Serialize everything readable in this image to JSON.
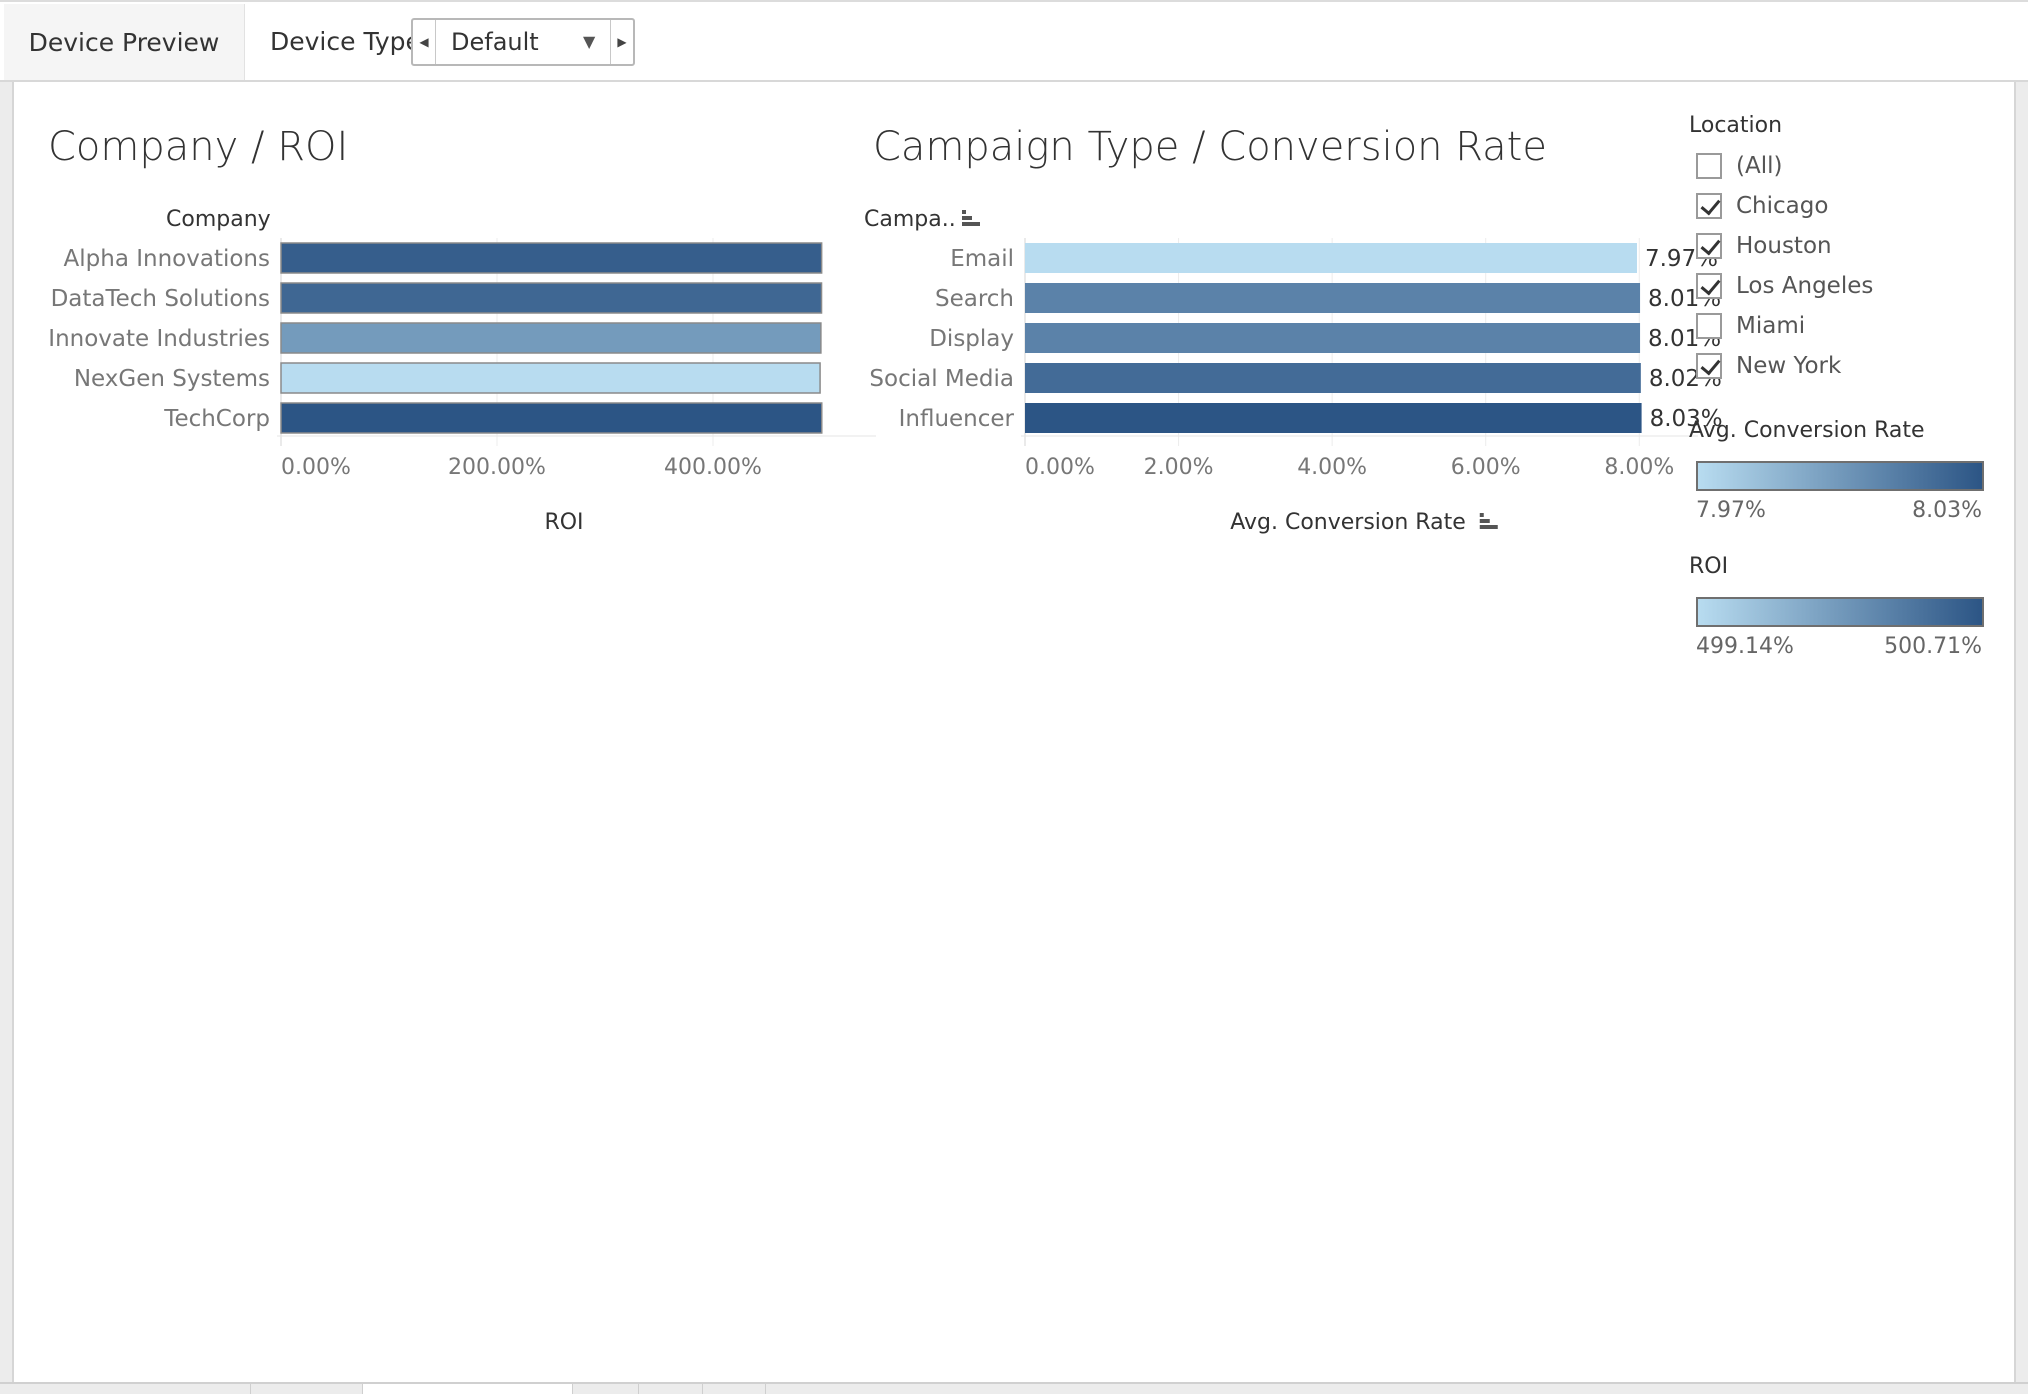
{
  "toolbar": {
    "tab_label": "Device Preview",
    "device_type_label": "Device Type",
    "device_type_value": "Default"
  },
  "charts_titles": {
    "roi_title": "Company / ROI",
    "conversion_title": "Campaign Type / Conversion Rate"
  },
  "chart_data": [
    {
      "type": "bar",
      "orientation": "horizontal",
      "title": "Company / ROI",
      "ylabel": "Company",
      "xlabel": "ROI",
      "categories": [
        "Alpha Innovations",
        "DataTech Solutions",
        "Innovate Industries",
        "NexGen Systems",
        "TechCorp"
      ],
      "values": [
        500.6,
        500.5,
        499.9,
        499.14,
        500.71
      ],
      "value_unit": "%",
      "xlim": [
        0,
        525
      ],
      "ticks": [
        {
          "value": 0,
          "label": "0.00%"
        },
        {
          "value": 200,
          "label": "200.00%"
        },
        {
          "value": 400,
          "label": "400.00%"
        }
      ],
      "color_scale": {
        "min": 499.14,
        "max": 500.71,
        "min_color": "#b8dcf0",
        "max_color": "#2c5585"
      },
      "grid": true
    },
    {
      "type": "bar",
      "orientation": "horizontal",
      "title": "Campaign Type / Conversion Rate",
      "ylabel": "Campa..",
      "xlabel": "Avg. Conversion Rate",
      "categories": [
        "Email",
        "Search",
        "Display",
        "Social Media",
        "Influencer"
      ],
      "values": [
        7.97,
        8.01,
        8.01,
        8.02,
        8.03
      ],
      "data_labels": [
        "7.97%",
        "8.01%",
        "8.01%",
        "8.02%",
        "8.03%"
      ],
      "value_unit": "%",
      "xlim": [
        0,
        8.4
      ],
      "ticks": [
        {
          "value": 0,
          "label": "0.00%"
        },
        {
          "value": 2,
          "label": "2.00%"
        },
        {
          "value": 4,
          "label": "4.00%"
        },
        {
          "value": 6,
          "label": "6.00%"
        },
        {
          "value": 8,
          "label": "8.00%"
        }
      ],
      "color_scale": {
        "min": 7.97,
        "max": 8.03,
        "min_color": "#b8dcf0",
        "max_color": "#2c5585"
      },
      "grid": true,
      "sorted": true
    }
  ],
  "location_filter": {
    "title": "Location",
    "items": [
      {
        "label": "(All)",
        "checked": false
      },
      {
        "label": "Chicago",
        "checked": true
      },
      {
        "label": "Houston",
        "checked": true
      },
      {
        "label": "Los Angeles",
        "checked": true
      },
      {
        "label": "Miami",
        "checked": false
      },
      {
        "label": "New York",
        "checked": true
      }
    ]
  },
  "legends": {
    "conversion": {
      "title": "Avg. Conversion Rate",
      "min": "7.97%",
      "max": "8.03%"
    },
    "roi": {
      "title": "ROI",
      "min": "499.14%",
      "max": "500.71%"
    }
  },
  "colors": {
    "scale_low": "#b8dcf0",
    "scale_high": "#2c5585",
    "sort_icon": "#555555"
  }
}
